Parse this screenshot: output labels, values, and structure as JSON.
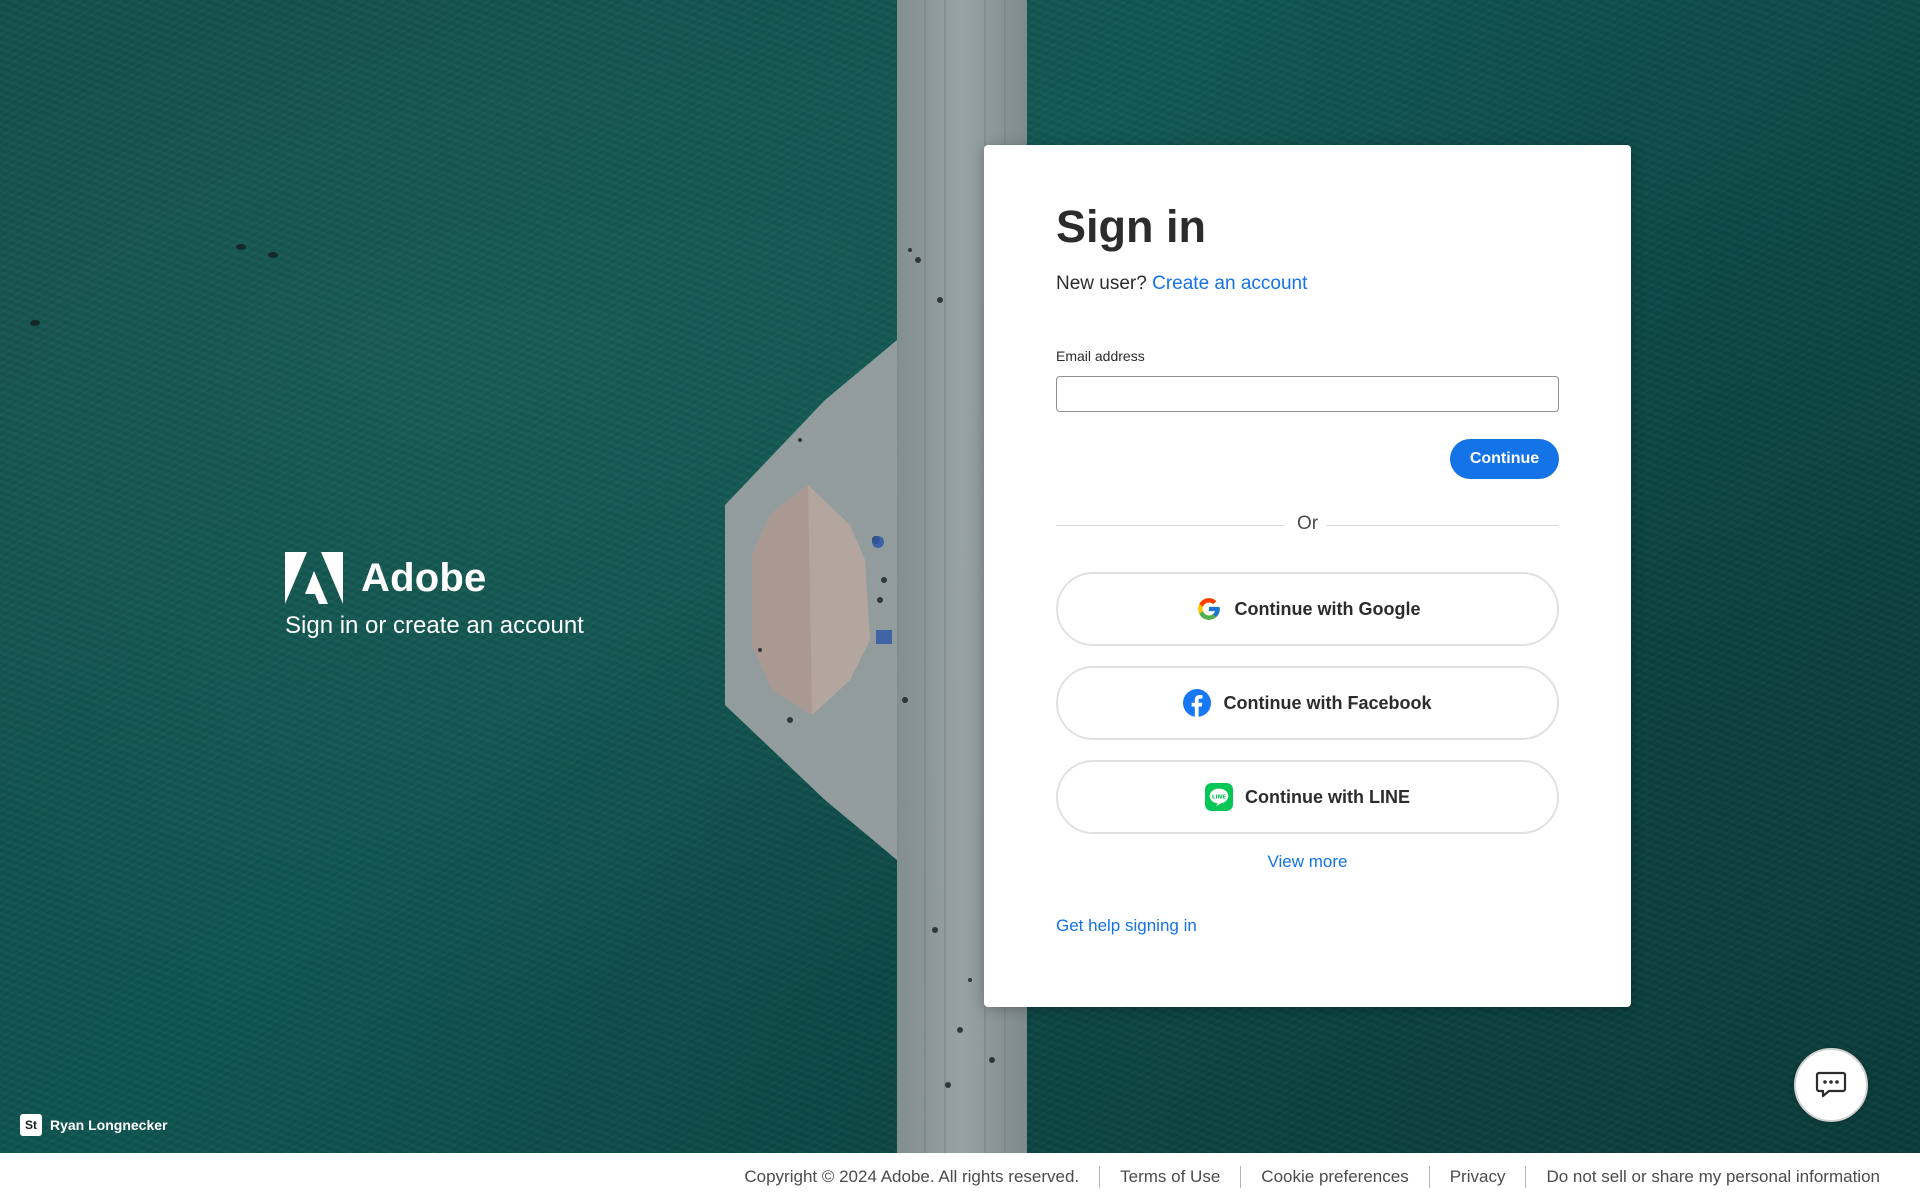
{
  "brand": {
    "name": "Adobe",
    "tagline": "Sign in or create an account"
  },
  "photo_credit": {
    "badge": "St",
    "name": "Ryan Longnecker"
  },
  "signin": {
    "title": "Sign in",
    "new_user_prompt": "New user?",
    "create_account_link": "Create an account",
    "email_label": "Email address",
    "email_value": "",
    "continue_label": "Continue",
    "or_label": "Or",
    "social_buttons": [
      {
        "label": "Continue with Google",
        "icon": "google-icon"
      },
      {
        "label": "Continue with Facebook",
        "icon": "facebook-icon"
      },
      {
        "label": "Continue with LINE",
        "icon": "line-icon"
      }
    ],
    "view_more": "View more",
    "help_link": "Get help signing in"
  },
  "chat": {
    "icon": "chat-icon"
  },
  "footer": {
    "copyright": "Copyright © 2024 Adobe. All rights reserved.",
    "links": [
      "Terms of Use",
      "Cookie preferences",
      "Privacy",
      "Do not sell or share my personal information"
    ]
  },
  "colors": {
    "accent": "#1473e6",
    "background_sea": "#0e5550",
    "card": "#ffffff",
    "text": "#2c2c2c"
  }
}
